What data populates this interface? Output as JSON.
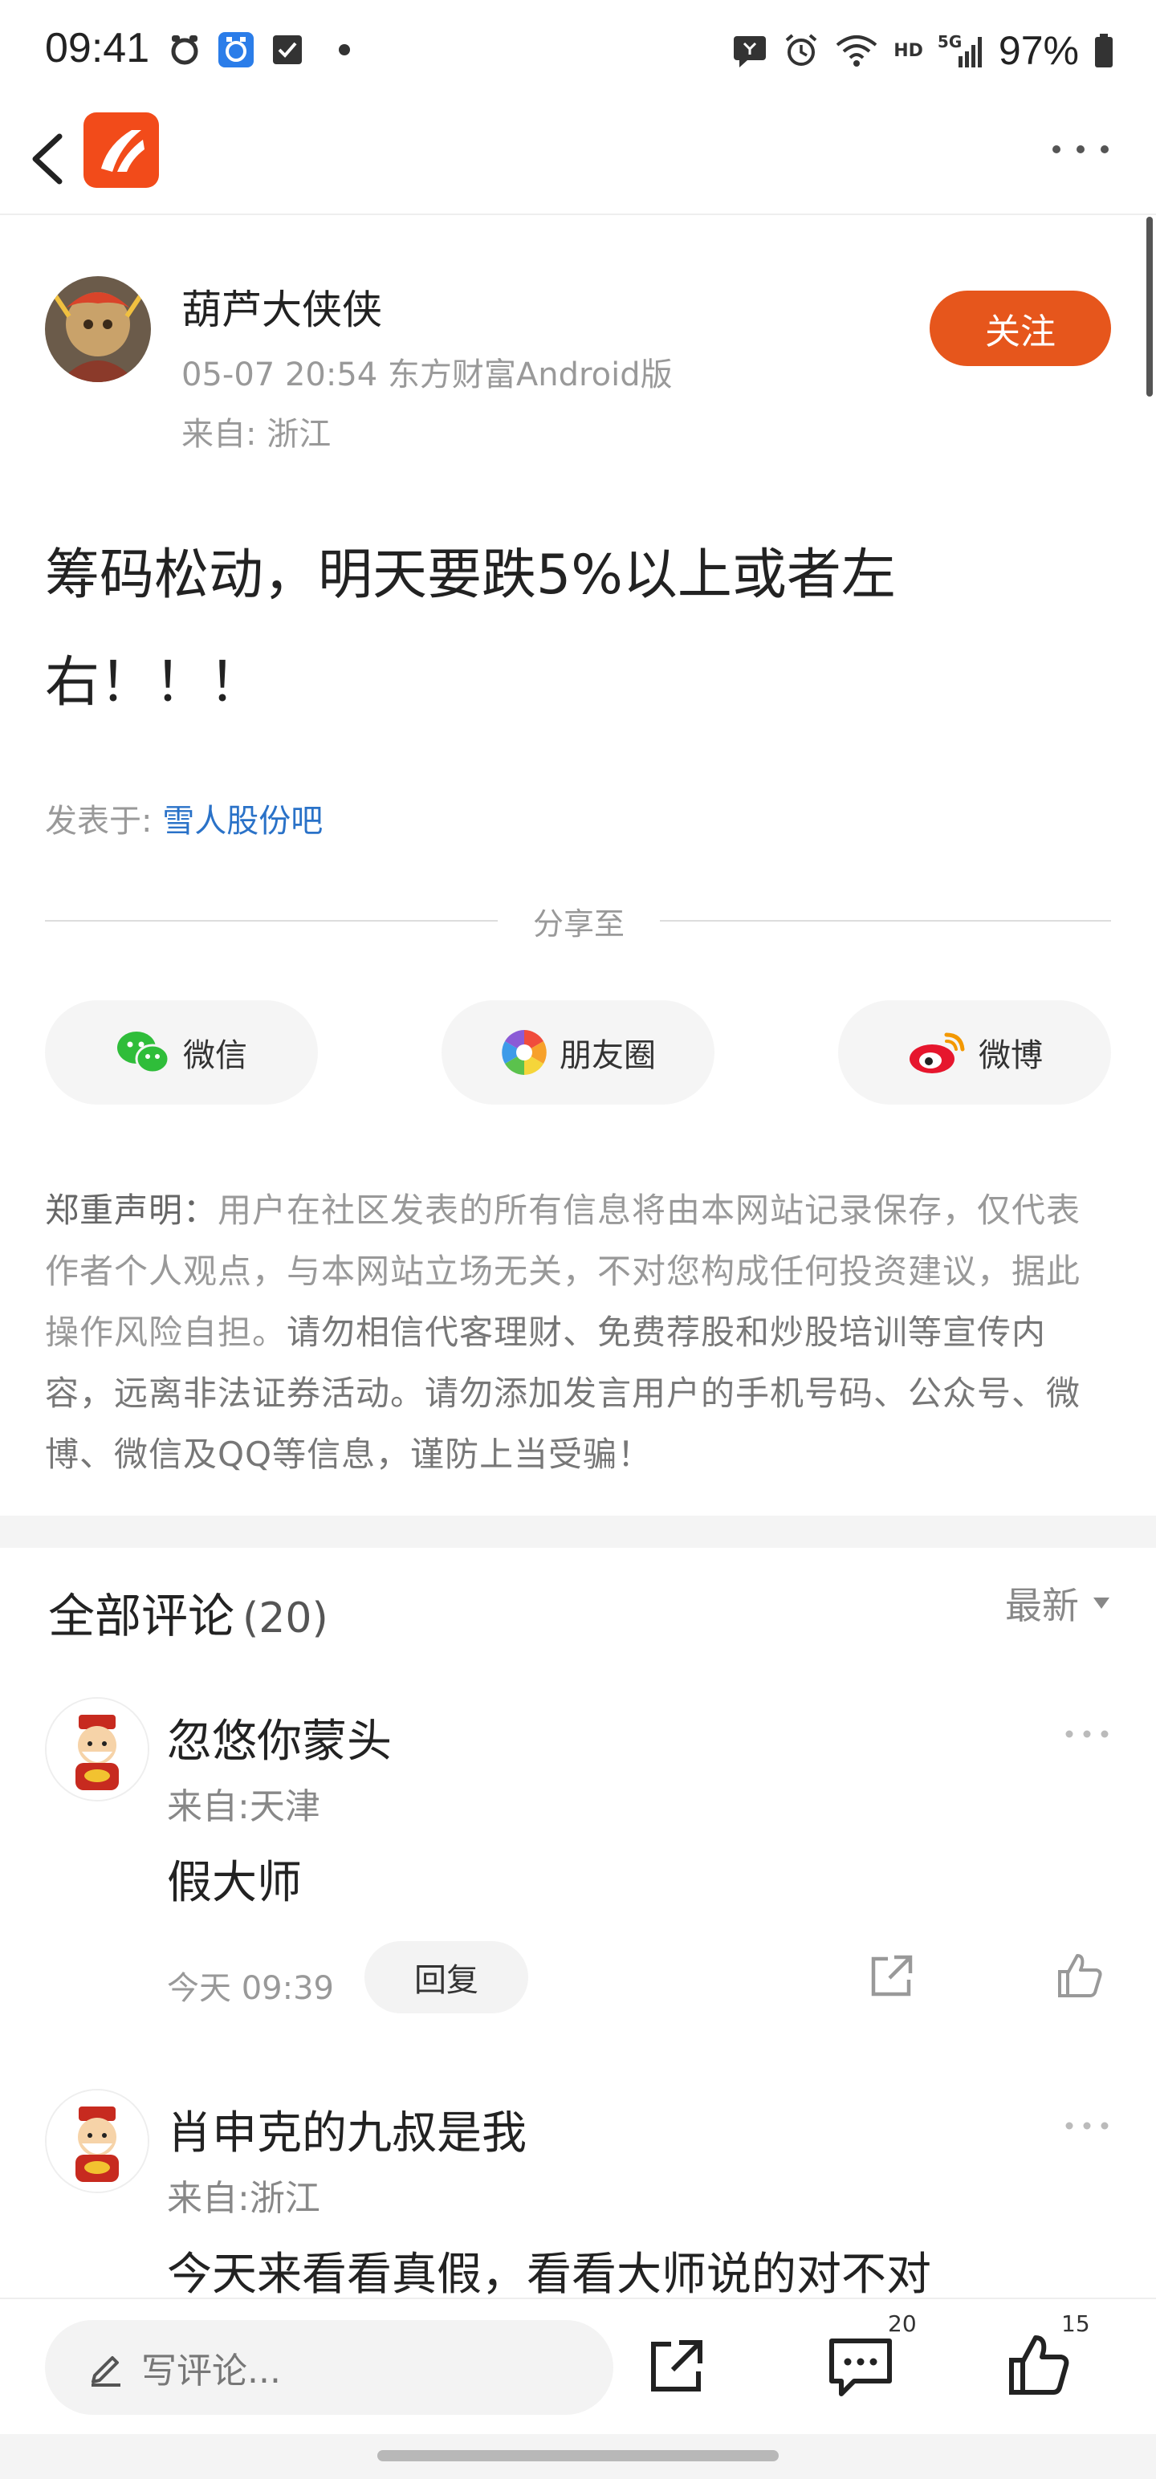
{
  "status_bar": {
    "time": "09:41",
    "network": "5G",
    "hd": "HD",
    "battery": "97%"
  },
  "nav": {
    "app_icon": "eastmoney-logo",
    "back_icon": "chevron-left-icon",
    "more_icon": "more-dots-icon"
  },
  "author": {
    "name": "葫芦大侠侠",
    "meta": "05-07 20:54 东方财富Android版",
    "from": "来自: 浙江",
    "follow_label": "关注"
  },
  "post": {
    "line1": "筹码松动，明天要跌5%以上或者左",
    "line2": "右！！！",
    "posted_in_label": "发表于: ",
    "posted_in_bar": "雪人股份吧"
  },
  "share": {
    "title": "分享至",
    "wechat": "微信",
    "moments": "朋友圈",
    "weibo": "微博"
  },
  "disclaimer": {
    "head": "郑重声明：",
    "part1": "用户在社区发表的所有信息将由本网站记录保存，仅代表作者个人观点，与本网站立场无关，不对您构成任何投资建议，据此操作风险自担。",
    "part2": "请勿相信代客理财、免费荐股和炒股培训等宣传内容，远离非法证券活动。请勿添加发言用户的手机号码、公众号、微博、微信及QQ等信息，谨防上当受骗！"
  },
  "comments": {
    "title": "全部评论",
    "count": "(20)",
    "sort_label": "最新",
    "items": [
      {
        "name": "忽悠你蒙头",
        "from": "来自:天津",
        "body": "假大师",
        "time": "今天 09:39",
        "reply_label": "回复"
      },
      {
        "name": "肖申克的九叔是我",
        "from": "来自:浙江",
        "body": "今天来看看真假，看看大师说的对不对"
      }
    ]
  },
  "bottom_bar": {
    "input_placeholder": "写评论...",
    "comment_count": "20",
    "like_count": "15"
  },
  "colors": {
    "accent": "#e6561c",
    "link": "#2a72c8",
    "muted": "#999999"
  }
}
